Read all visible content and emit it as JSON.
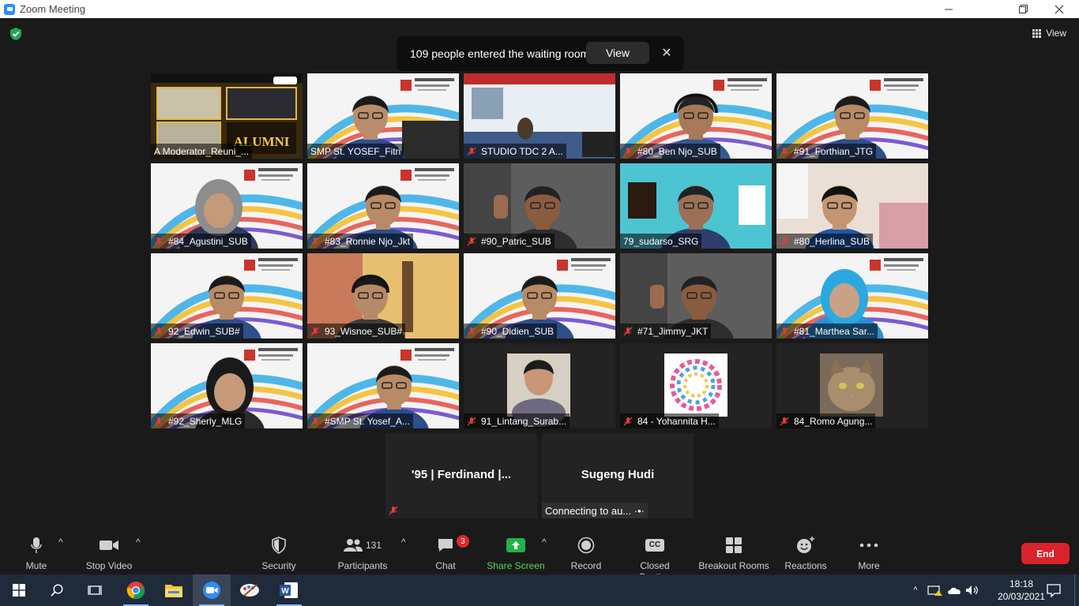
{
  "window": {
    "title": "Zoom Meeting"
  },
  "waiting_room": {
    "message": "109 people entered the waiting room",
    "view_label": "View",
    "close_label": "✕"
  },
  "view_button": {
    "label": "View"
  },
  "tiles": [
    {
      "name": "A Moderator_Reuni_...",
      "muted": false,
      "scene": "banner-live"
    },
    {
      "name": "SMP St. YOSEF_Fitri",
      "muted": false,
      "scene": "person-woman",
      "active": true
    },
    {
      "name": "STUDIO TDC 2 A...",
      "muted": true,
      "scene": "studio"
    },
    {
      "name": "#80_Ben Njo_SUB",
      "muted": true,
      "scene": "person-headset"
    },
    {
      "name": "#91_Forthian_JTG",
      "muted": true,
      "scene": "person-man"
    },
    {
      "name": "#84_Agustini_SUB",
      "muted": true,
      "scene": "person-hijab"
    },
    {
      "name": "#83_Ronnie Njo_Jkt",
      "muted": true,
      "scene": "person-man"
    },
    {
      "name": "#90_Patric_SUB",
      "muted": true,
      "scene": "person-dark"
    },
    {
      "name": "79_sudarso_SRG",
      "muted": false,
      "scene": "person-teal"
    },
    {
      "name": "#80_Herlina_SUB",
      "muted": true,
      "scene": "person-room"
    },
    {
      "name": "92_Edwin_SUB#",
      "muted": true,
      "scene": "person-man"
    },
    {
      "name": "93_Wisnoe_SUB#",
      "muted": true,
      "scene": "person-guitar"
    },
    {
      "name": "#90_Didien_SUB",
      "muted": true,
      "scene": "person-man"
    },
    {
      "name": "#71_Jimmy_JKT",
      "muted": true,
      "scene": "person-dark"
    },
    {
      "name": "#81_Marthea Sar...",
      "muted": true,
      "scene": "person-hijab-blue"
    },
    {
      "name": "#92_Sherly_MLG",
      "muted": true,
      "scene": "person-woman2"
    },
    {
      "name": "#SMP St. Yosef_A...",
      "muted": true,
      "scene": "person-man2"
    },
    {
      "name": "91_Lintang_Surab...",
      "muted": true,
      "scene": "photo-woman"
    },
    {
      "name": "84 - Yohannita H...",
      "muted": true,
      "scene": "photo-circle"
    },
    {
      "name": "84_Romo Agung...",
      "muted": true,
      "scene": "photo-cat"
    }
  ],
  "extra_tiles": [
    {
      "name": "'95 | Ferdinand |...",
      "muted": true,
      "status": ""
    },
    {
      "name": "Sugeng Hudi",
      "muted": false,
      "status": "Connecting to au... ·•·"
    }
  ],
  "toolbar": {
    "mute": "Mute",
    "stop_video": "Stop Video",
    "security": "Security",
    "participants": "Participants",
    "participants_count": "131",
    "chat": "Chat",
    "chat_badge": "3",
    "share_screen": "Share Screen",
    "record": "Record",
    "closed_caption": "Closed Caption",
    "closed_caption_icon_text": "CC",
    "breakout_rooms": "Breakout Rooms",
    "reactions": "Reactions",
    "more": "More",
    "end": "End"
  },
  "taskbar": {
    "time": "18:18",
    "date": "20/03/2021"
  },
  "colors": {
    "active_speaker": "#f0f262",
    "end_button": "#d9232d",
    "share_green": "#5ad45a",
    "zoom_blue": "#2d8cff"
  }
}
